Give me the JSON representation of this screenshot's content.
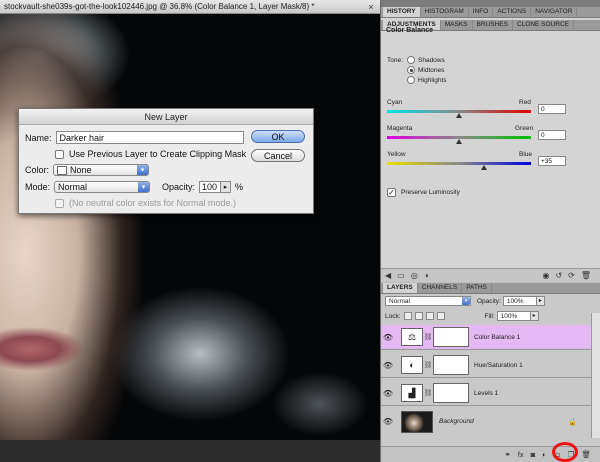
{
  "document": {
    "title": "stockvault-she039s-got-the-look102446.jpg @ 36.8% (Color Balance 1, Layer Mask/8) *",
    "close_glyph": "×"
  },
  "dialog": {
    "title": "New Layer",
    "name_label": "Name:",
    "name_value": "Darker hair",
    "clipping_label": "Use Previous Layer to Create Clipping Mask",
    "color_label": "Color:",
    "color_value": "None",
    "mode_label": "Mode:",
    "mode_value": "Normal",
    "opacity_label": "Opacity:",
    "opacity_value": "100",
    "opacity_unit": "%",
    "neutral_label": "(No neutral color exists for Normal mode.)",
    "ok_label": "OK",
    "cancel_label": "Cancel"
  },
  "top_tabs": [
    "HISTORY",
    "HISTOGRAM",
    "INFO",
    "ACTIONS",
    "NAVIGATOR"
  ],
  "adjust_tabs": [
    "ADJUSTMENTS",
    "MASKS",
    "BRUSHES",
    "CLONE SOURCE"
  ],
  "adjustments": {
    "title": "Color Balance",
    "tone_label": "Tone:",
    "tones": [
      "Shadows",
      "Midtones",
      "Highlights"
    ],
    "selected_tone": "Midtones",
    "sliders": [
      {
        "left": "Cyan",
        "right": "Red",
        "value": "0",
        "level": 0
      },
      {
        "left": "Magenta",
        "right": "Green",
        "value": "0",
        "level": 0
      },
      {
        "left": "Yellow",
        "right": "Blue",
        "value": "+35",
        "level": 35
      }
    ],
    "preserve_label": "Preserve Luminosity",
    "preserve_checked": true
  },
  "layers_tabs": [
    "LAYERS",
    "CHANNELS",
    "PATHS"
  ],
  "layers": {
    "blend_mode": "Normal",
    "opacity_label": "Opacity:",
    "opacity_value": "100%",
    "lock_label": "Lock:",
    "fill_label": "Fill:",
    "fill_value": "100%",
    "items": [
      {
        "name": "Color Balance 1",
        "selected": true
      },
      {
        "name": "Hue/Saturation 1",
        "selected": false
      },
      {
        "name": "Levels 1",
        "selected": false
      },
      {
        "name": "Background",
        "selected": false
      }
    ]
  },
  "colors": {
    "selected_layer": "#e4b8f2",
    "highlight": "#e11111"
  }
}
